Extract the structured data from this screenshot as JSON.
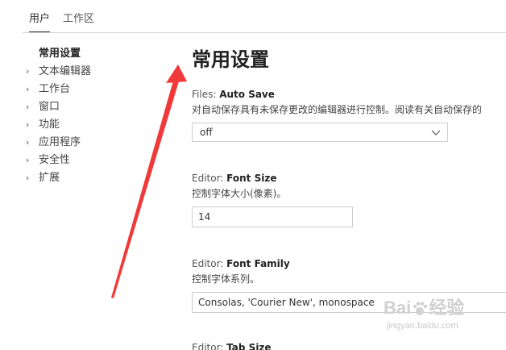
{
  "tabs": {
    "user": "用户",
    "workspace": "工作区"
  },
  "toc": {
    "selected": "常用设置",
    "items": [
      "文本编辑器",
      "工作台",
      "窗口",
      "功能",
      "应用程序",
      "安全性",
      "扩展"
    ]
  },
  "main": {
    "title": "常用设置",
    "settings": [
      {
        "category": "Files: ",
        "key": "Auto Save",
        "description": "对自动保存具有未保存更改的编辑器进行控制。阅读有关自动保存的",
        "value": "off"
      },
      {
        "category": "Editor: ",
        "key": "Font Size",
        "description": "控制字体大小(像素)。",
        "value": "14"
      },
      {
        "category": "Editor: ",
        "key": "Font Family",
        "description": "控制字体系列。",
        "value": "Consolas, 'Courier New', monospace"
      },
      {
        "category": "Editor: ",
        "key": "Tab Size"
      }
    ]
  },
  "annotation": {
    "arrow_color": "#f03a3a"
  },
  "watermark": {
    "logo": "Bai",
    "logo_suffix": "经验",
    "url": "jingyan.baidu.com"
  }
}
